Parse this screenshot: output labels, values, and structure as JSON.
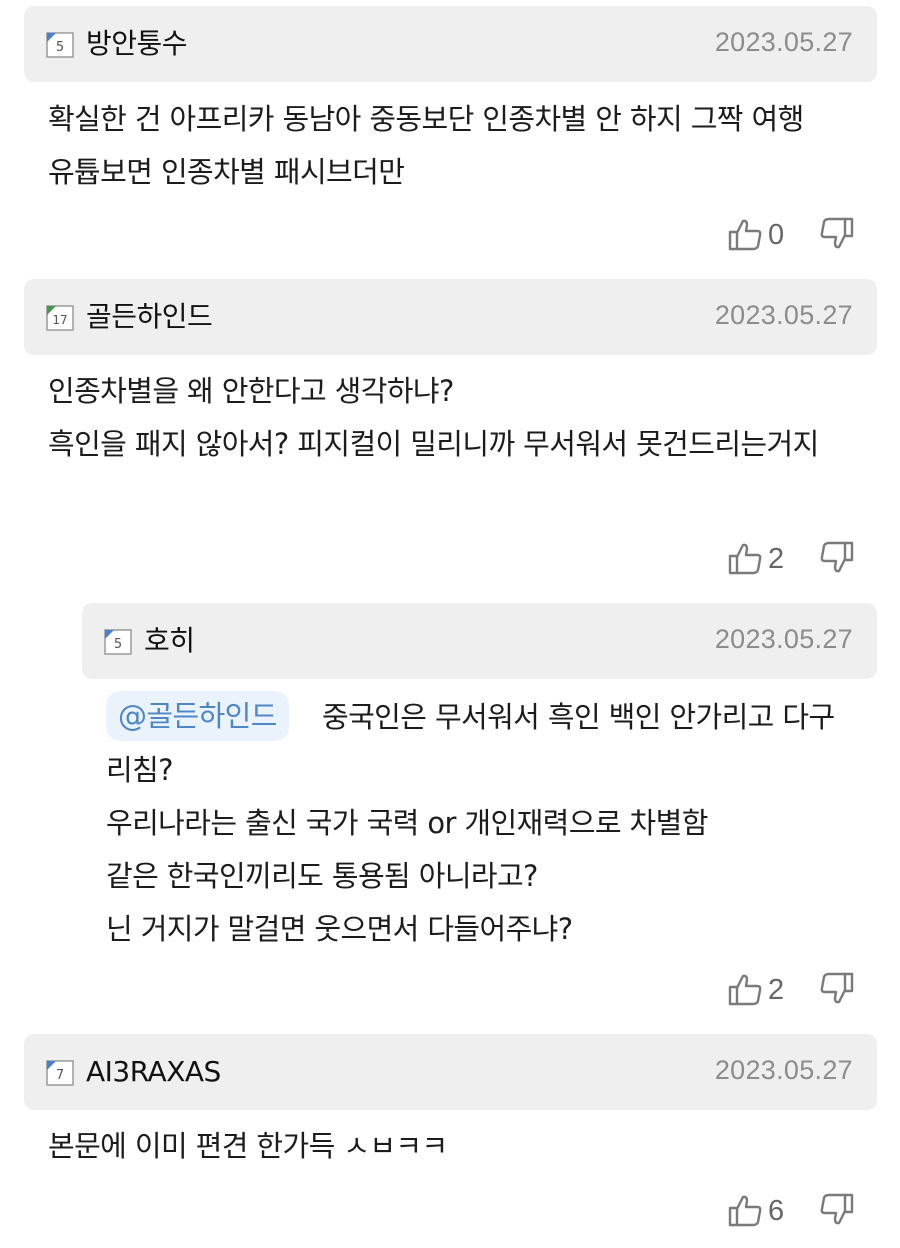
{
  "comments": [
    {
      "level": "5",
      "nickname": "방안퉁수",
      "date": "2023.05.27",
      "lines": [
        "확실한 건 아프리카 동남아 중동보단 인종차별 안 하지 그짝 여행",
        "유튭보면 인종차별 패시브더만"
      ],
      "likes": "0"
    },
    {
      "level": "17",
      "nickname": "골든하인드",
      "date": "2023.05.27",
      "lines": [
        "인종차별을 왜 안한다고 생각하냐?",
        "흑인을 패지 않아서? 피지컬이 밀리니까 무서워서 못건드리는거지"
      ],
      "likes": "2"
    },
    {
      "level": "5",
      "nickname": "호히",
      "date": "2023.05.27",
      "mention": "@골든하인드",
      "lines": [
        "중국인은 무서워서 흑인 백인 안가리고 다구",
        "리침?",
        "우리나라는 출신 국가 국력 or 개인재력으로 차별함",
        "같은 한국인끼리도 통용됨 아니라고?",
        "닌 거지가 말걸면 웃으면서 다들어주냐?"
      ],
      "likes": "2"
    },
    {
      "level": "7",
      "nickname": "AI3RAXAS",
      "date": "2023.05.27",
      "lines": [
        "본문에 이미 편견 한가득 ㅅㅂㅋㅋ"
      ],
      "likes": "6"
    }
  ],
  "icons": {
    "like": "thumbs-up-icon",
    "dislike": "thumbs-down-icon",
    "level": "level-badge-icon"
  },
  "colors": {
    "header_bg": "#efefef",
    "mention_bg": "#eaf2fb",
    "mention_text": "#4f86c6",
    "date_text": "#8c8c8c",
    "badge_blue": "#4a7fd0",
    "badge_green": "#3f9a4b"
  }
}
